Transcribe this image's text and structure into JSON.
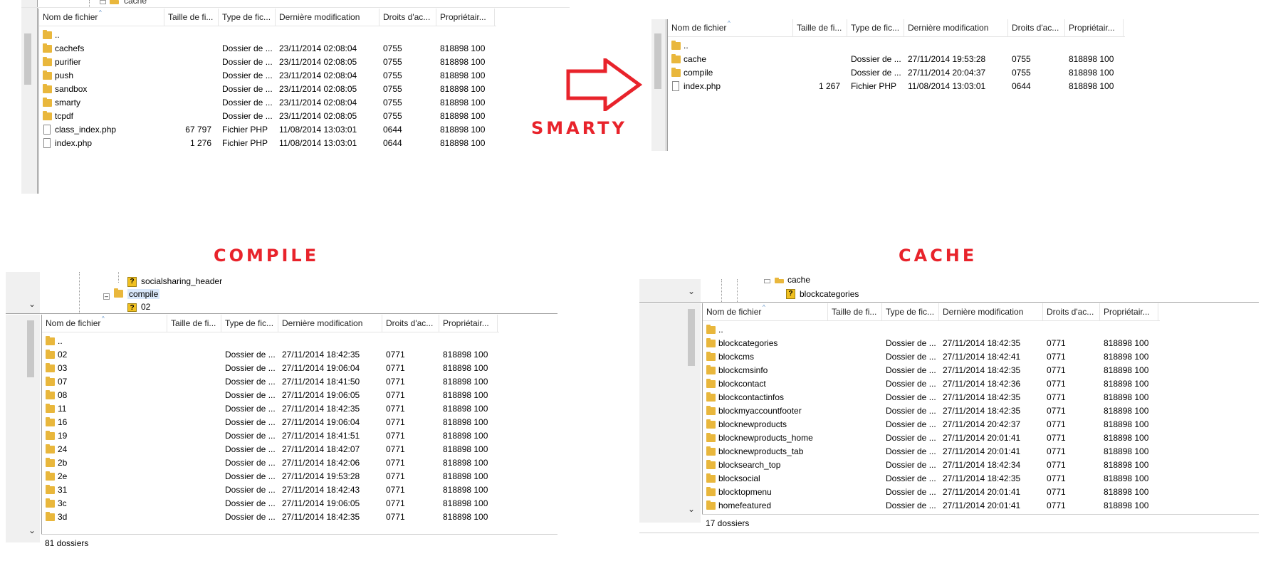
{
  "captions": {
    "smarty": "SMARTY",
    "compile": "COMPILE",
    "cache": "CACHE"
  },
  "columns": {
    "name": "Nom de fichier",
    "size": "Taille de fi...",
    "type": "Type de fic...",
    "modified": "Dernière modification",
    "rights": "Droits d'ac...",
    "owner": "Propriétair..."
  },
  "panel_top_left": {
    "tree_label": "cache",
    "rows": [
      {
        "icon": "folder-icon",
        "name": "..",
        "size": "",
        "type": "",
        "modified": "",
        "rights": "",
        "owner": ""
      },
      {
        "icon": "folder-icon",
        "name": "cachefs",
        "size": "",
        "type": "Dossier de ...",
        "modified": "23/11/2014 02:08:04",
        "rights": "0755",
        "owner": "818898 100"
      },
      {
        "icon": "folder-icon",
        "name": "purifier",
        "size": "",
        "type": "Dossier de ...",
        "modified": "23/11/2014 02:08:05",
        "rights": "0755",
        "owner": "818898 100"
      },
      {
        "icon": "folder-icon",
        "name": "push",
        "size": "",
        "type": "Dossier de ...",
        "modified": "23/11/2014 02:08:04",
        "rights": "0755",
        "owner": "818898 100"
      },
      {
        "icon": "folder-icon",
        "name": "sandbox",
        "size": "",
        "type": "Dossier de ...",
        "modified": "23/11/2014 02:08:05",
        "rights": "0755",
        "owner": "818898 100"
      },
      {
        "icon": "folder-icon",
        "name": "smarty",
        "size": "",
        "type": "Dossier de ...",
        "modified": "23/11/2014 02:08:04",
        "rights": "0755",
        "owner": "818898 100"
      },
      {
        "icon": "folder-icon",
        "name": "tcpdf",
        "size": "",
        "type": "Dossier de ...",
        "modified": "23/11/2014 02:08:05",
        "rights": "0755",
        "owner": "818898 100"
      },
      {
        "icon": "file-icon",
        "name": "class_index.php",
        "size": "67 797",
        "type": "Fichier PHP",
        "modified": "11/08/2014 13:03:01",
        "rights": "0644",
        "owner": "818898 100"
      },
      {
        "icon": "file-icon",
        "name": "index.php",
        "size": "1 276",
        "type": "Fichier PHP",
        "modified": "11/08/2014 13:03:01",
        "rights": "0644",
        "owner": "818898 100"
      }
    ]
  },
  "panel_top_right": {
    "rows": [
      {
        "icon": "folder-icon",
        "name": "..",
        "size": "",
        "type": "",
        "modified": "",
        "rights": "",
        "owner": ""
      },
      {
        "icon": "folder-icon",
        "name": "cache",
        "size": "",
        "type": "Dossier de ...",
        "modified": "27/11/2014 19:53:28",
        "rights": "0755",
        "owner": "818898 100"
      },
      {
        "icon": "folder-icon",
        "name": "compile",
        "size": "",
        "type": "Dossier de ...",
        "modified": "27/11/2014 20:04:37",
        "rights": "0755",
        "owner": "818898 100"
      },
      {
        "icon": "file-icon",
        "name": "index.php",
        "size": "1 267",
        "type": "Fichier PHP",
        "modified": "11/08/2014 13:03:01",
        "rights": "0644",
        "owner": "818898 100"
      }
    ]
  },
  "panel_bottom_left": {
    "tree": {
      "item1": "socialsharing_header",
      "item2": "compile",
      "item3": "02"
    },
    "status": "81 dossiers",
    "rows": [
      {
        "icon": "folder-icon",
        "name": "..",
        "size": "",
        "type": "",
        "modified": "",
        "rights": "",
        "owner": ""
      },
      {
        "icon": "folder-icon",
        "name": "02",
        "size": "",
        "type": "Dossier de ...",
        "modified": "27/11/2014 18:42:35",
        "rights": "0771",
        "owner": "818898 100"
      },
      {
        "icon": "folder-icon",
        "name": "03",
        "size": "",
        "type": "Dossier de ...",
        "modified": "27/11/2014 19:06:04",
        "rights": "0771",
        "owner": "818898 100"
      },
      {
        "icon": "folder-icon",
        "name": "07",
        "size": "",
        "type": "Dossier de ...",
        "modified": "27/11/2014 18:41:50",
        "rights": "0771",
        "owner": "818898 100"
      },
      {
        "icon": "folder-icon",
        "name": "08",
        "size": "",
        "type": "Dossier de ...",
        "modified": "27/11/2014 19:06:05",
        "rights": "0771",
        "owner": "818898 100"
      },
      {
        "icon": "folder-icon",
        "name": "11",
        "size": "",
        "type": "Dossier de ...",
        "modified": "27/11/2014 18:42:35",
        "rights": "0771",
        "owner": "818898 100"
      },
      {
        "icon": "folder-icon",
        "name": "16",
        "size": "",
        "type": "Dossier de ...",
        "modified": "27/11/2014 19:06:04",
        "rights": "0771",
        "owner": "818898 100"
      },
      {
        "icon": "folder-icon",
        "name": "19",
        "size": "",
        "type": "Dossier de ...",
        "modified": "27/11/2014 18:41:51",
        "rights": "0771",
        "owner": "818898 100"
      },
      {
        "icon": "folder-icon",
        "name": "24",
        "size": "",
        "type": "Dossier de ...",
        "modified": "27/11/2014 18:42:07",
        "rights": "0771",
        "owner": "818898 100"
      },
      {
        "icon": "folder-icon",
        "name": "2b",
        "size": "",
        "type": "Dossier de ...",
        "modified": "27/11/2014 18:42:06",
        "rights": "0771",
        "owner": "818898 100"
      },
      {
        "icon": "folder-icon",
        "name": "2e",
        "size": "",
        "type": "Dossier de ...",
        "modified": "27/11/2014 19:53:28",
        "rights": "0771",
        "owner": "818898 100"
      },
      {
        "icon": "folder-icon",
        "name": "31",
        "size": "",
        "type": "Dossier de ...",
        "modified": "27/11/2014 18:42:43",
        "rights": "0771",
        "owner": "818898 100"
      },
      {
        "icon": "folder-icon",
        "name": "3c",
        "size": "",
        "type": "Dossier de ...",
        "modified": "27/11/2014 19:06:05",
        "rights": "0771",
        "owner": "818898 100"
      },
      {
        "icon": "folder-icon",
        "name": "3d",
        "size": "",
        "type": "Dossier de ...",
        "modified": "27/11/2014 18:42:35",
        "rights": "0771",
        "owner": "818898 100"
      }
    ]
  },
  "panel_bottom_right": {
    "tree": {
      "item1": "cache",
      "item2": "blockcategories"
    },
    "status": "17 dossiers",
    "rows": [
      {
        "icon": "folder-icon",
        "name": "..",
        "size": "",
        "type": "",
        "modified": "",
        "rights": "",
        "owner": ""
      },
      {
        "icon": "folder-icon",
        "name": "blockcategories",
        "size": "",
        "type": "Dossier de ...",
        "modified": "27/11/2014 18:42:35",
        "rights": "0771",
        "owner": "818898 100"
      },
      {
        "icon": "folder-icon",
        "name": "blockcms",
        "size": "",
        "type": "Dossier de ...",
        "modified": "27/11/2014 18:42:41",
        "rights": "0771",
        "owner": "818898 100"
      },
      {
        "icon": "folder-icon",
        "name": "blockcmsinfo",
        "size": "",
        "type": "Dossier de ...",
        "modified": "27/11/2014 18:42:35",
        "rights": "0771",
        "owner": "818898 100"
      },
      {
        "icon": "folder-icon",
        "name": "blockcontact",
        "size": "",
        "type": "Dossier de ...",
        "modified": "27/11/2014 18:42:36",
        "rights": "0771",
        "owner": "818898 100"
      },
      {
        "icon": "folder-icon",
        "name": "blockcontactinfos",
        "size": "",
        "type": "Dossier de ...",
        "modified": "27/11/2014 18:42:35",
        "rights": "0771",
        "owner": "818898 100"
      },
      {
        "icon": "folder-icon",
        "name": "blockmyaccountfooter",
        "size": "",
        "type": "Dossier de ...",
        "modified": "27/11/2014 18:42:35",
        "rights": "0771",
        "owner": "818898 100"
      },
      {
        "icon": "folder-icon",
        "name": "blocknewproducts",
        "size": "",
        "type": "Dossier de ...",
        "modified": "27/11/2014 20:42:37",
        "rights": "0771",
        "owner": "818898 100"
      },
      {
        "icon": "folder-icon",
        "name": "blocknewproducts_home",
        "size": "",
        "type": "Dossier de ...",
        "modified": "27/11/2014 20:01:41",
        "rights": "0771",
        "owner": "818898 100"
      },
      {
        "icon": "folder-icon",
        "name": "blocknewproducts_tab",
        "size": "",
        "type": "Dossier de ...",
        "modified": "27/11/2014 20:01:41",
        "rights": "0771",
        "owner": "818898 100"
      },
      {
        "icon": "folder-icon",
        "name": "blocksearch_top",
        "size": "",
        "type": "Dossier de ...",
        "modified": "27/11/2014 18:42:34",
        "rights": "0771",
        "owner": "818898 100"
      },
      {
        "icon": "folder-icon",
        "name": "blocksocial",
        "size": "",
        "type": "Dossier de ...",
        "modified": "27/11/2014 18:42:35",
        "rights": "0771",
        "owner": "818898 100"
      },
      {
        "icon": "folder-icon",
        "name": "blocktopmenu",
        "size": "",
        "type": "Dossier de ...",
        "modified": "27/11/2014 20:01:41",
        "rights": "0771",
        "owner": "818898 100"
      },
      {
        "icon": "folder-icon",
        "name": "homefeatured",
        "size": "",
        "type": "Dossier de ...",
        "modified": "27/11/2014 20:01:41",
        "rights": "0771",
        "owner": "818898 100"
      }
    ]
  },
  "colors": {
    "caption": "#e8232b",
    "folder": "#e9b73c",
    "arrow": "#e8232b"
  },
  "icons": {
    "arrow": "right-arrow-icon",
    "folder": "folder-icon",
    "file": "file-icon",
    "sort": "sort-ascending-icon",
    "unknown": "question-icon"
  }
}
